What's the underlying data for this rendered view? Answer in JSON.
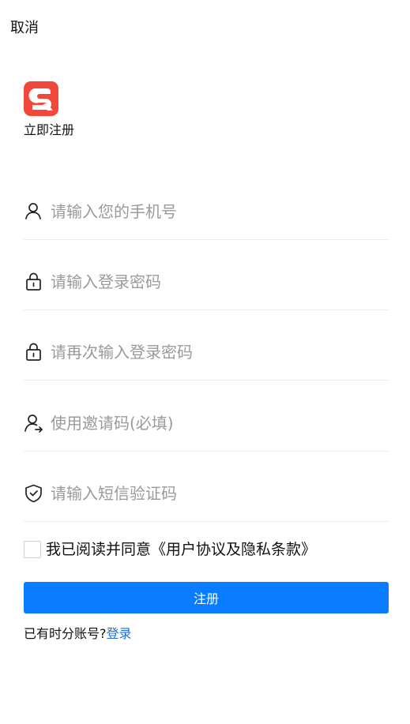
{
  "header": {
    "cancel_label": "取消"
  },
  "brand": {
    "logo_icon": "red-square-sr-logo",
    "logo_color": "#f2473b",
    "subtitle": "立即注册"
  },
  "form": {
    "phone": {
      "placeholder": "请输入您的手机号",
      "icon": "user-icon",
      "value": ""
    },
    "password": {
      "placeholder": "请输入登录密码",
      "icon": "lock-icon",
      "value": ""
    },
    "confirm_password": {
      "placeholder": "请再次输入登录密码",
      "icon": "lock-icon",
      "value": ""
    },
    "invite_code": {
      "placeholder": "使用邀请码(必填)",
      "icon": "user-share-icon",
      "value": ""
    },
    "sms_code": {
      "placeholder": "请输入短信验证码",
      "icon": "shield-check-icon",
      "value": ""
    }
  },
  "agreement": {
    "checked": false,
    "text": "我已阅读并同意《用户协议及隐私条款》"
  },
  "actions": {
    "register_label": "注册",
    "register_color": "#0a7cff"
  },
  "footer": {
    "have_account_text": "已有时分账号?",
    "login_label": "登录",
    "login_color": "#1f6fd8"
  }
}
